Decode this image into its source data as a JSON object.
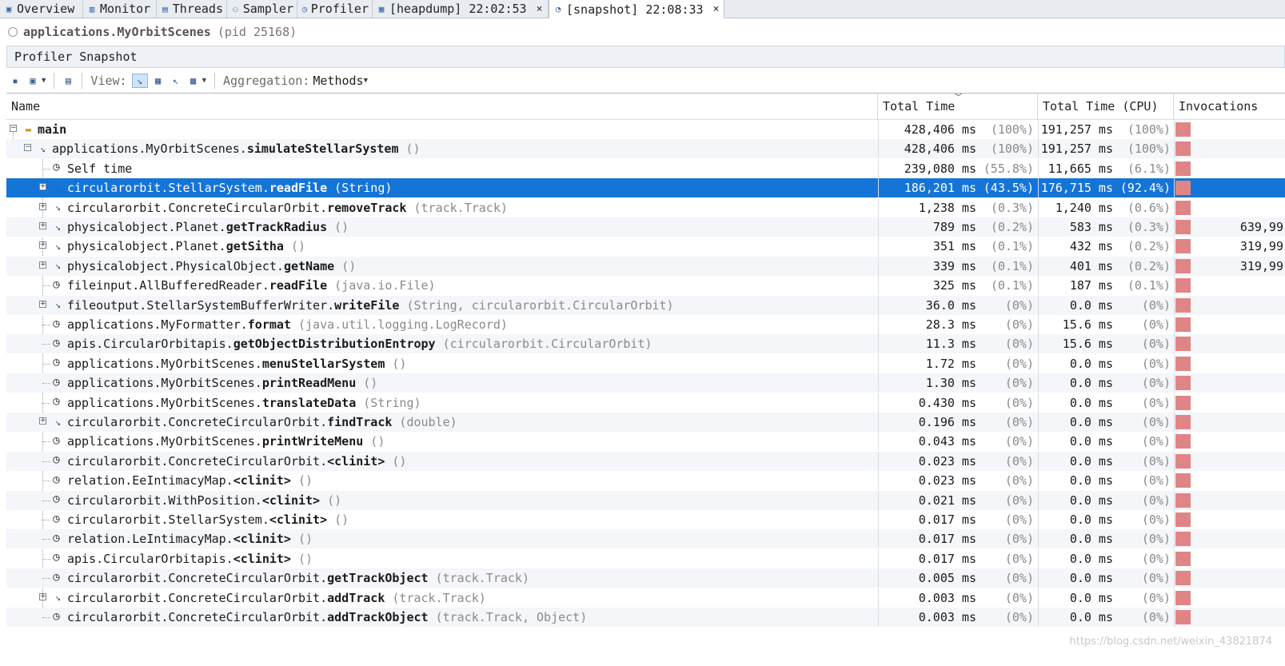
{
  "tabs": [
    {
      "label": "Overview",
      "icon": "overview-icon",
      "close": ""
    },
    {
      "label": "Monitor",
      "icon": "monitor-icon",
      "close": ""
    },
    {
      "label": "Threads",
      "icon": "threads-icon",
      "close": ""
    },
    {
      "label": "Sampler",
      "icon": "sampler-icon",
      "close": ""
    },
    {
      "label": "Profiler",
      "icon": "profiler-icon",
      "close": ""
    },
    {
      "label": "[heapdump] 22:02:53",
      "icon": "heapdump-icon",
      "close": "×"
    },
    {
      "label": "[snapshot] 22:08:33",
      "icon": "snapshot-icon",
      "close": "×"
    }
  ],
  "process": {
    "name": "applications.MyOrbitScenes",
    "pid": "(pid 25168)"
  },
  "snapshot_title": "Profiler Snapshot",
  "toolbar": {
    "view_label": "View:",
    "aggregation_label": "Aggregation:",
    "aggregation_value": "Methods"
  },
  "columns": {
    "name": "Name",
    "total_time": "Total Time",
    "total_time_cpu": "Total Time (CPU)",
    "invocations": "Invocations"
  },
  "rows": [
    {
      "depth": 0,
      "expander": "minus",
      "icon": "thread",
      "cls": "",
      "meth": "main",
      "params": "",
      "t": "428,406 ms",
      "tp": "(100%)",
      "c": "191,257 ms",
      "cp": "(100%)",
      "inv": "",
      "bar": 1.0
    },
    {
      "depth": 1,
      "expander": "minus",
      "icon": "method",
      "cls": "applications.MyOrbitScenes.",
      "meth": "simulateStellarSystem",
      "params": " ()",
      "t": "428,406 ms",
      "tp": "(100%)",
      "c": "191,257 ms",
      "cp": "(100%)",
      "inv": "",
      "bar": 1.0
    },
    {
      "depth": 2,
      "expander": "",
      "icon": "clock",
      "cls": "Self time",
      "meth": "",
      "params": "",
      "t": "239,080 ms",
      "tp": "(55.8%)",
      "c": "11,665 ms",
      "cp": "(6.1%)",
      "inv": "",
      "bar": 1.0
    },
    {
      "depth": 2,
      "expander": "plus",
      "icon": "method",
      "cls": "circularorbit.StellarSystem.",
      "meth": "readFile",
      "params": " (String)",
      "t": "186,201 ms",
      "tp": "(43.5%)",
      "c": "176,715 ms",
      "cp": "(92.4%)",
      "inv": "",
      "bar": 1.0,
      "selected": true
    },
    {
      "depth": 2,
      "expander": "plus",
      "icon": "method",
      "cls": "circularorbit.ConcreteCircularOrbit.",
      "meth": "removeTrack",
      "params": " (track.Track)",
      "t": "1,238 ms",
      "tp": "(0.3%)",
      "c": "1,240 ms",
      "cp": "(0.6%)",
      "inv": "",
      "bar": 1.0
    },
    {
      "depth": 2,
      "expander": "plus",
      "icon": "method",
      "cls": "physicalobject.Planet.",
      "meth": "getTrackRadius",
      "params": " ()",
      "t": "789 ms",
      "tp": "(0.2%)",
      "c": "583 ms",
      "cp": "(0.3%)",
      "inv": "639,99",
      "bar": 1.0
    },
    {
      "depth": 2,
      "expander": "plus",
      "icon": "method",
      "cls": "physicalobject.Planet.",
      "meth": "getSitha",
      "params": " ()",
      "t": "351 ms",
      "tp": "(0.1%)",
      "c": "432 ms",
      "cp": "(0.2%)",
      "inv": "319,99",
      "bar": 1.0
    },
    {
      "depth": 2,
      "expander": "plus",
      "icon": "method",
      "cls": "physicalobject.PhysicalObject.",
      "meth": "getName",
      "params": " ()",
      "t": "339 ms",
      "tp": "(0.1%)",
      "c": "401 ms",
      "cp": "(0.2%)",
      "inv": "319,99",
      "bar": 1.0
    },
    {
      "depth": 2,
      "expander": "",
      "icon": "clock",
      "cls": "fileinput.AllBufferedReader.",
      "meth": "readFile",
      "params": " (java.io.File)",
      "t": "325 ms",
      "tp": "(0.1%)",
      "c": "187 ms",
      "cp": "(0.1%)",
      "inv": "",
      "bar": 1.0
    },
    {
      "depth": 2,
      "expander": "plus",
      "icon": "method",
      "cls": "fileoutput.StellarSystemBufferWriter.",
      "meth": "writeFile",
      "params": " (String, circularorbit.CircularOrbit)",
      "t": "36.0 ms",
      "tp": "(0%)",
      "c": "0.0 ms",
      "cp": "(0%)",
      "inv": "",
      "bar": 1.0
    },
    {
      "depth": 2,
      "expander": "",
      "icon": "clock",
      "cls": "applications.MyFormatter.",
      "meth": "format",
      "params": " (java.util.logging.LogRecord)",
      "t": "28.3 ms",
      "tp": "(0%)",
      "c": "15.6 ms",
      "cp": "(0%)",
      "inv": "",
      "bar": 1.0
    },
    {
      "depth": 2,
      "expander": "",
      "icon": "clock",
      "cls": "apis.CircularOrbitapis.",
      "meth": "getObjectDistributionEntropy",
      "params": " (circularorbit.CircularOrbit)",
      "t": "11.3 ms",
      "tp": "(0%)",
      "c": "15.6 ms",
      "cp": "(0%)",
      "inv": "",
      "bar": 1.0
    },
    {
      "depth": 2,
      "expander": "",
      "icon": "clock",
      "cls": "applications.MyOrbitScenes.",
      "meth": "menuStellarSystem",
      "params": " ()",
      "t": "1.72 ms",
      "tp": "(0%)",
      "c": "0.0 ms",
      "cp": "(0%)",
      "inv": "",
      "bar": 1.0
    },
    {
      "depth": 2,
      "expander": "",
      "icon": "clock",
      "cls": "applications.MyOrbitScenes.",
      "meth": "printReadMenu",
      "params": " ()",
      "t": "1.30 ms",
      "tp": "(0%)",
      "c": "0.0 ms",
      "cp": "(0%)",
      "inv": "",
      "bar": 1.0
    },
    {
      "depth": 2,
      "expander": "",
      "icon": "clock",
      "cls": "applications.MyOrbitScenes.",
      "meth": "translateData",
      "params": " (String)",
      "t": "0.430 ms",
      "tp": "(0%)",
      "c": "0.0 ms",
      "cp": "(0%)",
      "inv": "",
      "bar": 1.0
    },
    {
      "depth": 2,
      "expander": "plus",
      "icon": "method",
      "cls": "circularorbit.ConcreteCircularOrbit.",
      "meth": "findTrack",
      "params": " (double)",
      "t": "0.196 ms",
      "tp": "(0%)",
      "c": "0.0 ms",
      "cp": "(0%)",
      "inv": "",
      "bar": 1.0
    },
    {
      "depth": 2,
      "expander": "",
      "icon": "clock",
      "cls": "applications.MyOrbitScenes.",
      "meth": "printWriteMenu",
      "params": " ()",
      "t": "0.043 ms",
      "tp": "(0%)",
      "c": "0.0 ms",
      "cp": "(0%)",
      "inv": "",
      "bar": 1.0
    },
    {
      "depth": 2,
      "expander": "",
      "icon": "clock",
      "cls": "circularorbit.ConcreteCircularOrbit.",
      "meth": "<clinit>",
      "params": " ()",
      "t": "0.023 ms",
      "tp": "(0%)",
      "c": "0.0 ms",
      "cp": "(0%)",
      "inv": "",
      "bar": 1.0
    },
    {
      "depth": 2,
      "expander": "",
      "icon": "clock",
      "cls": "relation.EeIntimacyMap.",
      "meth": "<clinit>",
      "params": " ()",
      "t": "0.023 ms",
      "tp": "(0%)",
      "c": "0.0 ms",
      "cp": "(0%)",
      "inv": "",
      "bar": 1.0
    },
    {
      "depth": 2,
      "expander": "",
      "icon": "clock",
      "cls": "circularorbit.WithPosition.",
      "meth": "<clinit>",
      "params": " ()",
      "t": "0.021 ms",
      "tp": "(0%)",
      "c": "0.0 ms",
      "cp": "(0%)",
      "inv": "",
      "bar": 1.0
    },
    {
      "depth": 2,
      "expander": "",
      "icon": "clock",
      "cls": "circularorbit.StellarSystem.",
      "meth": "<clinit>",
      "params": " ()",
      "t": "0.017 ms",
      "tp": "(0%)",
      "c": "0.0 ms",
      "cp": "(0%)",
      "inv": "",
      "bar": 1.0
    },
    {
      "depth": 2,
      "expander": "",
      "icon": "clock",
      "cls": "relation.LeIntimacyMap.",
      "meth": "<clinit>",
      "params": " ()",
      "t": "0.017 ms",
      "tp": "(0%)",
      "c": "0.0 ms",
      "cp": "(0%)",
      "inv": "",
      "bar": 1.0
    },
    {
      "depth": 2,
      "expander": "",
      "icon": "clock",
      "cls": "apis.CircularOrbitapis.",
      "meth": "<clinit>",
      "params": " ()",
      "t": "0.017 ms",
      "tp": "(0%)",
      "c": "0.0 ms",
      "cp": "(0%)",
      "inv": "",
      "bar": 1.0
    },
    {
      "depth": 2,
      "expander": "",
      "icon": "clock",
      "cls": "circularorbit.ConcreteCircularOrbit.",
      "meth": "getTrackObject",
      "params": " (track.Track)",
      "t": "0.005 ms",
      "tp": "(0%)",
      "c": "0.0 ms",
      "cp": "(0%)",
      "inv": "",
      "bar": 1.0
    },
    {
      "depth": 2,
      "expander": "plus",
      "icon": "method",
      "cls": "circularorbit.ConcreteCircularOrbit.",
      "meth": "addTrack",
      "params": " (track.Track)",
      "t": "0.003 ms",
      "tp": "(0%)",
      "c": "0.0 ms",
      "cp": "(0%)",
      "inv": "",
      "bar": 1.0
    },
    {
      "depth": 2,
      "expander": "",
      "icon": "clock",
      "cls": "circularorbit.ConcreteCircularOrbit.",
      "meth": "addTrackObject",
      "params": " (track.Track, Object)",
      "t": "0.003 ms",
      "tp": "(0%)",
      "c": "0.0 ms",
      "cp": "(0%)",
      "inv": "",
      "bar": 1.0
    }
  ],
  "watermark": "https://blog.csdn.net/weixin_43821874",
  "colors": {
    "selection": "#1574d8",
    "bar": "#e08585",
    "alt_row": "#f4f6f9"
  }
}
